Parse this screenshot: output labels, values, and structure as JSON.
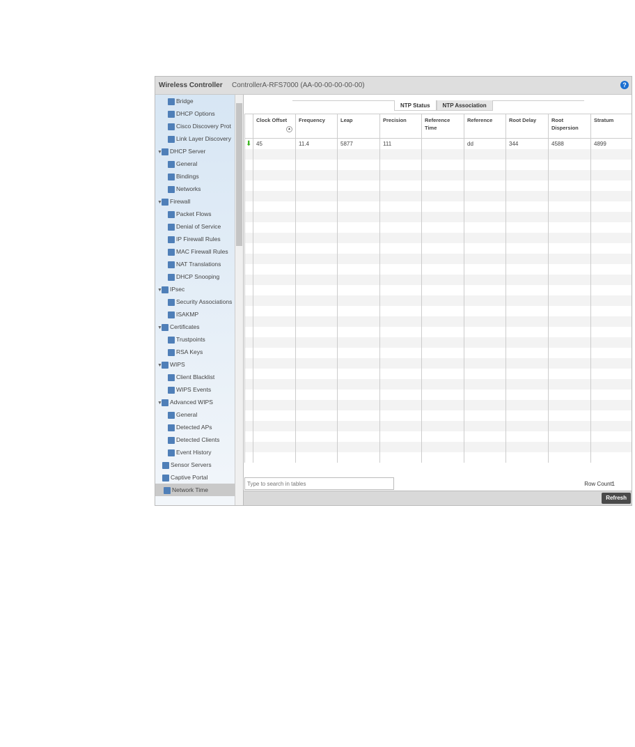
{
  "header": {
    "title": "Wireless Controller",
    "subtitle": "ControllerA-RFS7000 (AA-00-00-00-00-00)",
    "help_icon": "?"
  },
  "sidebar": {
    "items": [
      {
        "label": "Bridge",
        "level": 1
      },
      {
        "label": "DHCP Options",
        "level": 1
      },
      {
        "label": "Cisco Discovery Prot",
        "level": 1
      },
      {
        "label": "Link Layer Discovery",
        "level": 1
      },
      {
        "label": "DHCP Server",
        "level": 0
      },
      {
        "label": "General",
        "level": 1
      },
      {
        "label": "Bindings",
        "level": 1
      },
      {
        "label": "Networks",
        "level": 1
      },
      {
        "label": "Firewall",
        "level": 0
      },
      {
        "label": "Packet Flows",
        "level": 1
      },
      {
        "label": "Denial of Service",
        "level": 1
      },
      {
        "label": "IP Firewall Rules",
        "level": 1
      },
      {
        "label": "MAC Firewall Rules",
        "level": 1
      },
      {
        "label": "NAT Translations",
        "level": 1
      },
      {
        "label": "DHCP Snooping",
        "level": 1
      },
      {
        "label": "IPsec",
        "level": 0
      },
      {
        "label": "Security Associations",
        "level": 1
      },
      {
        "label": "ISAKMP",
        "level": 1
      },
      {
        "label": "Certificates",
        "level": 0
      },
      {
        "label": "Trustpoints",
        "level": 1
      },
      {
        "label": "RSA Keys",
        "level": 1
      },
      {
        "label": "WIPS",
        "level": 0
      },
      {
        "label": "Client Blacklist",
        "level": 1
      },
      {
        "label": "WIPS Events",
        "level": 1
      },
      {
        "label": "Advanced WIPS",
        "level": 0
      },
      {
        "label": "General",
        "level": 1
      },
      {
        "label": "Detected APs",
        "level": 1
      },
      {
        "label": "Detected Clients",
        "level": 1
      },
      {
        "label": "Event History",
        "level": 1
      },
      {
        "label": "Sensor Servers",
        "level": -1
      },
      {
        "label": "Captive Portal",
        "level": -1
      },
      {
        "label": "Network Time",
        "level": -1,
        "selected": true
      }
    ]
  },
  "tabs": [
    "NTP Status",
    "NTP Association"
  ],
  "table": {
    "columns": [
      "Clock Offset",
      "Frequency",
      "Leap",
      "Precision",
      "Reference Time",
      "Reference",
      "Root Delay",
      "Root Dispersion",
      "Stratum"
    ],
    "rows": [
      [
        "45",
        "11.4",
        "5877",
        "111",
        "",
        "dd",
        "344",
        "4588",
        "4899"
      ]
    ],
    "empty_rows": 30
  },
  "footer": {
    "search_placeholder": "Type to search in tables",
    "row_count_label": "Row Count:",
    "row_count": "1",
    "refresh": "Refresh"
  },
  "colors": {
    "status_up": "#3cb521",
    "selected": "#c9c9c9"
  }
}
